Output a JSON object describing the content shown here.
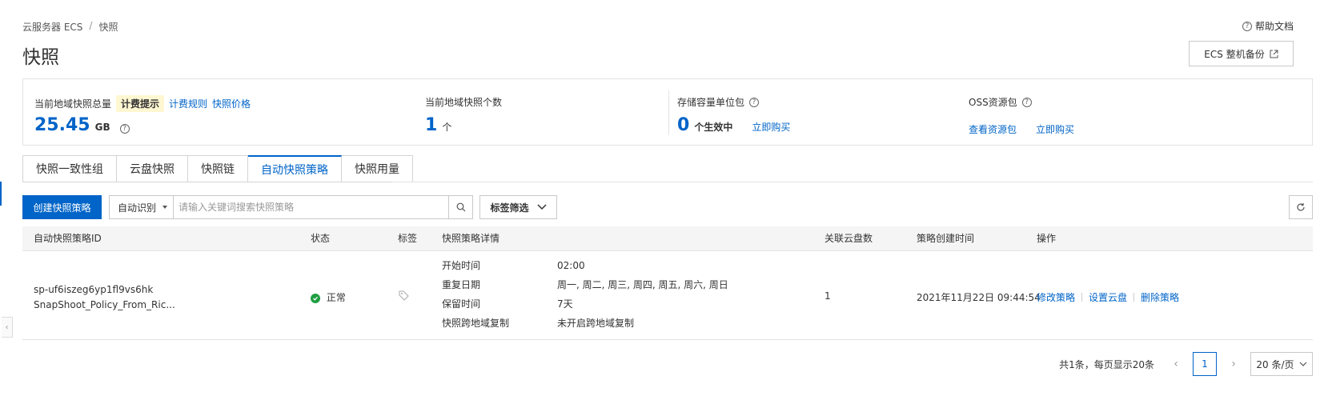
{
  "breadcrumb": {
    "root": "云服务器 ECS",
    "separator": "/",
    "current": "快照"
  },
  "page_title": "快照",
  "help_doc": "帮助文档",
  "ecs_backup_button": "ECS 整机备份",
  "stats": {
    "total_label": "当前地域快照总量",
    "billing_tag": "计费提示",
    "billing_rules": "计费规则",
    "snapshot_price": "快照价格",
    "total_value": "25.45",
    "total_unit": "GB",
    "count_label": "当前地域快照个数",
    "count_value": "1",
    "count_unit": "个",
    "storage_label": "存储容量单位包",
    "storage_value": "0",
    "storage_unit": "个生效中",
    "storage_buy": "立即购买",
    "oss_label": "OSS资源包",
    "oss_view": "查看资源包",
    "oss_buy": "立即购买"
  },
  "tabs": [
    {
      "label": "快照一致性组",
      "active": false
    },
    {
      "label": "云盘快照",
      "active": false
    },
    {
      "label": "快照链",
      "active": false
    },
    {
      "label": "自动快照策略",
      "active": true
    },
    {
      "label": "快照用量",
      "active": false
    }
  ],
  "toolbar": {
    "create_button": "创建快照策略",
    "search_mode": "自动识别",
    "search_placeholder": "请输入关键词搜索快照策略",
    "tag_filter": "标签筛选"
  },
  "table": {
    "headers": {
      "policy_id": "自动快照策略ID",
      "status": "状态",
      "tags": "标签",
      "details": "快照策略详情",
      "disk_count": "关联云盘数",
      "created": "策略创建时间",
      "actions": "操作"
    },
    "rows": [
      {
        "policy_id": "sp-uf6iszeg6yp1fl9vs6hk",
        "policy_name": "SnapShoot_Policy_From_Ric...",
        "status": "正常",
        "details": [
          {
            "label": "开始时间",
            "value": "02:00"
          },
          {
            "label": "重复日期",
            "value": "周一, 周二, 周三, 周四, 周五, 周六, 周日"
          },
          {
            "label": "保留时间",
            "value": "7天"
          },
          {
            "label": "快照跨地域复制",
            "value": "未开启跨地域复制"
          }
        ],
        "disk_count": "1",
        "created": "2021年11月22日 09:44:54",
        "actions": [
          "修改策略",
          "设置云盘",
          "删除策略"
        ]
      }
    ]
  },
  "pagination": {
    "summary": "共1条，每页显示20条",
    "current_page": "1",
    "page_size": "20 条/页"
  }
}
